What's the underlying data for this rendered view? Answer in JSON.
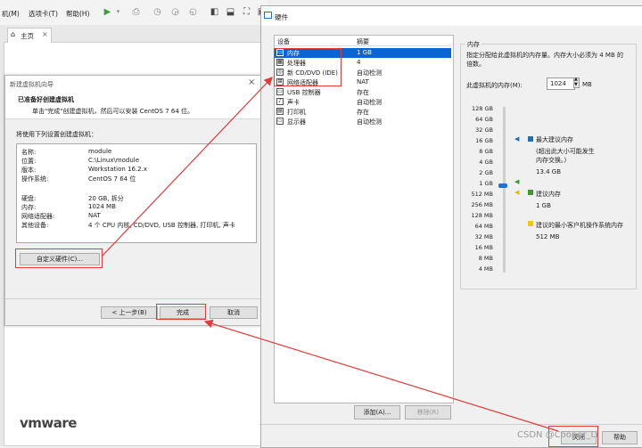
{
  "workstation": {
    "menu": [
      "机(M)",
      "选项卡(T)",
      "帮助(H)"
    ],
    "home_tab": "主页",
    "logo": "vmware"
  },
  "wizard": {
    "title": "新建虚拟机向导",
    "heading": "已准备好创建虚拟机",
    "subheading": "单击\"完成\"创建虚拟机，然后可以安装 CentOS 7 64 位。",
    "intro": "将使用下列设置创建虚拟机：",
    "summary": [
      {
        "k": "名称:",
        "v": "module"
      },
      {
        "k": "位置:",
        "v": "C:\\Linux\\module"
      },
      {
        "k": "版本:",
        "v": "Workstation 16.2.x"
      },
      {
        "k": "操作系统:",
        "v": "CentOS 7 64 位"
      },
      {
        "k": "硬盘:",
        "v": "20 GB, 拆分"
      },
      {
        "k": "内存:",
        "v": "1024 MB"
      },
      {
        "k": "网络适配器:",
        "v": "NAT"
      },
      {
        "k": "其他设备:",
        "v": "4 个 CPU 内核, CD/DVD, USB 控制器, 打印机, 声卡"
      }
    ],
    "customize_button": "自定义硬件(C)...",
    "back_button": "< 上一步(B)",
    "finish_button": "完成",
    "cancel_button": "取消"
  },
  "hardware": {
    "title": "硬件",
    "col_device": "设备",
    "col_summary": "摘要",
    "devices": [
      {
        "name": "内存",
        "summary": "1 GB",
        "icon": "memory-icon",
        "glyph": "▭"
      },
      {
        "name": "处理器",
        "summary": "4",
        "icon": "cpu-icon",
        "glyph": "▦"
      },
      {
        "name": "新 CD/DVD (IDE)",
        "summary": "自动检测",
        "icon": "cd-icon",
        "glyph": "◎"
      },
      {
        "name": "网络适配器",
        "summary": "NAT",
        "icon": "network-icon",
        "glyph": "⊞"
      },
      {
        "name": "USB 控制器",
        "summary": "存在",
        "icon": "usb-icon",
        "glyph": "▭"
      },
      {
        "name": "声卡",
        "summary": "自动检测",
        "icon": "speaker-icon",
        "glyph": "♪"
      },
      {
        "name": "打印机",
        "summary": "存在",
        "icon": "printer-icon",
        "glyph": "▤"
      },
      {
        "name": "显示器",
        "summary": "自动检测",
        "icon": "monitor-icon",
        "glyph": "▭"
      }
    ],
    "memory_group_title": "内存",
    "memory_desc": "指定分配给此虚拟机的内存量。内存大小必须为 4 MB 的倍数。",
    "memory_label": "此虚拟机的内存(M):",
    "memory_value": "1024",
    "memory_unit": "MB",
    "scale": [
      "128 GB",
      "64 GB",
      "32 GB",
      "16 GB",
      "8 GB",
      "4 GB",
      "2 GB",
      "1 GB",
      "512 MB",
      "256 MB",
      "128 MB",
      "64 MB",
      "32 MB",
      "16 MB",
      "8 MB",
      "4 MB"
    ],
    "max_rec_label": "最大建议内存",
    "max_rec_note": "(超出此大小可能发生内存交换。)",
    "max_rec_value": "13.4 GB",
    "rec_label": "建议内存",
    "rec_value": "1 GB",
    "min_rec_label": "建议的最小客户机操作系统内存",
    "min_rec_value": "512 MB",
    "add_button": "添加(A)...",
    "remove_button": "移除(R)",
    "close_button": "关闭",
    "help_button": "帮助",
    "colors": {
      "selection": "#0a64d2",
      "max": "#1f6fb5",
      "rec": "#3a9a2c",
      "min": "#f0c419",
      "annotation": "#e23b3b"
    }
  },
  "watermark": "CSDN @Cooper_Li"
}
